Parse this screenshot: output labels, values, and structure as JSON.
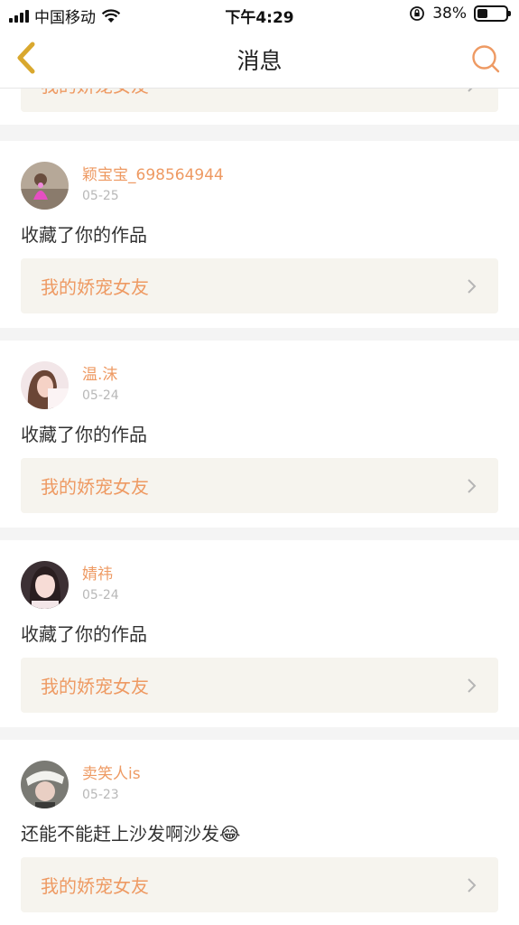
{
  "status_bar": {
    "carrier": "中国移动",
    "time": "下午4:29",
    "battery": "38%",
    "battery_level": 0.38
  },
  "nav": {
    "title": "消息",
    "back_icon": "chevron-left-icon",
    "search_icon": "search-icon"
  },
  "colors": {
    "accent": "#ee9a63",
    "link_bg": "#f6f4ee"
  },
  "partial_card": {
    "work_title": "我的娇宠女友"
  },
  "items": [
    {
      "username": "颖宝宝_698564944",
      "date": "05-25",
      "message": "收藏了你的作品",
      "work_title": "我的娇宠女友"
    },
    {
      "username": "温.沫",
      "date": "05-24",
      "message": "收藏了你的作品",
      "work_title": "我的娇宠女友"
    },
    {
      "username": "婧祎",
      "date": "05-24",
      "message": "收藏了你的作品",
      "work_title": "我的娇宠女友"
    },
    {
      "username": "卖笑人is",
      "date": "05-23",
      "message": "还能不能赶上沙发啊沙发😂",
      "work_title": "我的娇宠女友"
    }
  ]
}
